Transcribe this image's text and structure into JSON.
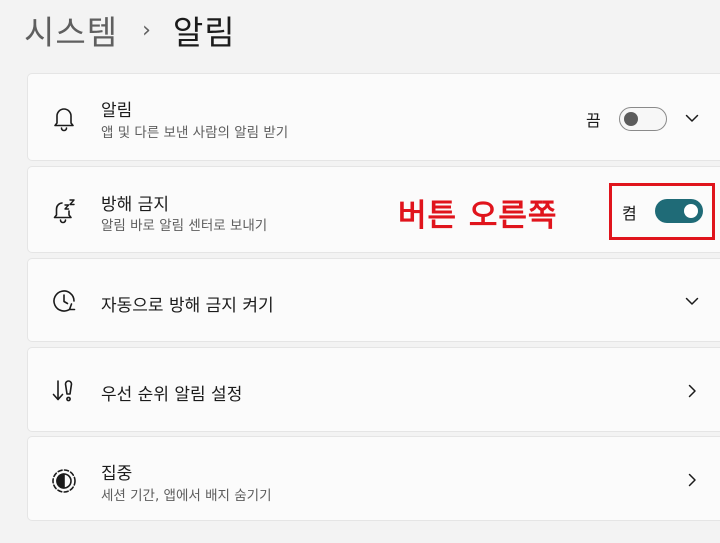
{
  "breadcrumb": {
    "parent": "시스템",
    "separator": "›",
    "current": "알림"
  },
  "settings": [
    {
      "title": "알림",
      "subtitle": "앱 및 다른 보낸 사람의 알림 받기",
      "icon": "bell-icon",
      "toggle_state_label": "끔",
      "toggle_on": false,
      "control": "chevron-down"
    },
    {
      "title": "방해 금지",
      "subtitle": "알림 바로 알림 센터로 보내기",
      "icon": "bell-zz-icon",
      "toggle_state_label": "켬",
      "toggle_on": true,
      "control": "none"
    },
    {
      "title": "자동으로 방해 금지 켜기",
      "icon": "clock-icon",
      "control": "chevron-down"
    },
    {
      "title": "우선 순위 알림 설정",
      "icon": "priority-icon",
      "control": "chevron-right"
    },
    {
      "title": "집중",
      "subtitle": "세션 기간, 앱에서 배지 숨기기",
      "icon": "focus-icon",
      "control": "chevron-right"
    }
  ],
  "annotation": {
    "text": "버튼 오른쪽",
    "color": "#e0141c"
  },
  "colors": {
    "accent": "#1f6b77",
    "background": "#f3f3f3",
    "card": "#fbfbfb"
  }
}
